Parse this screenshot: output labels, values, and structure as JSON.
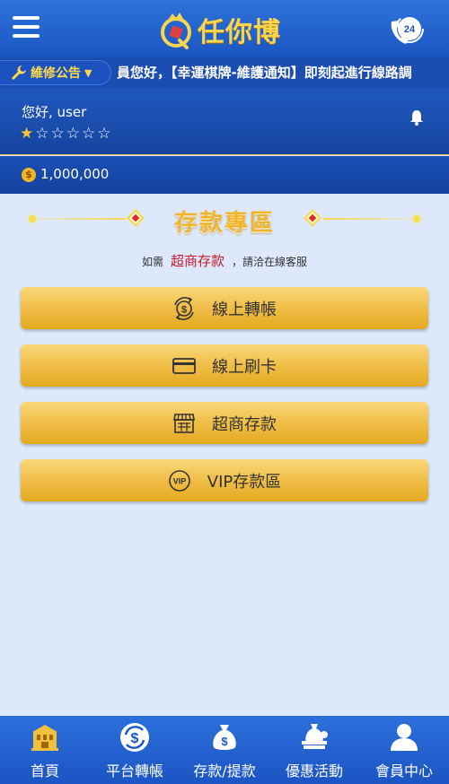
{
  "header": {
    "brand": "任你博",
    "support_badge": "24"
  },
  "notice": {
    "tag_label": "維修公告",
    "marquee": "員您好，【幸運棋牌-維護通知】即刻起進行線路調"
  },
  "user": {
    "greeting": "您好,  user",
    "stars_filled": 1,
    "stars_total": 6,
    "balance": "1,000,000"
  },
  "section": {
    "title": "存款專區",
    "hint_prefix": "如需",
    "hint_highlight": "超商存款",
    "hint_suffix": "，請洽在線客服"
  },
  "buttons": [
    {
      "label": "線上轉帳",
      "icon": "transfer-icon"
    },
    {
      "label": "線上刷卡",
      "icon": "card-icon"
    },
    {
      "label": "超商存款",
      "icon": "store-icon"
    },
    {
      "label": "VIP存款區",
      "icon": "vip-icon"
    }
  ],
  "nav": [
    {
      "label": "首頁",
      "icon": "home-building-icon"
    },
    {
      "label": "平台轉帳",
      "icon": "dollar-exchange-icon"
    },
    {
      "label": "存款/提款",
      "icon": "money-bag-icon"
    },
    {
      "label": "優惠活動",
      "icon": "promotion-icon"
    },
    {
      "label": "會員中心",
      "icon": "member-icon"
    }
  ],
  "colors": {
    "header_blue": "#1a56c2",
    "gold": "#f1c04c",
    "highlight_red": "#c41a2a",
    "background": "#dde8fb"
  }
}
